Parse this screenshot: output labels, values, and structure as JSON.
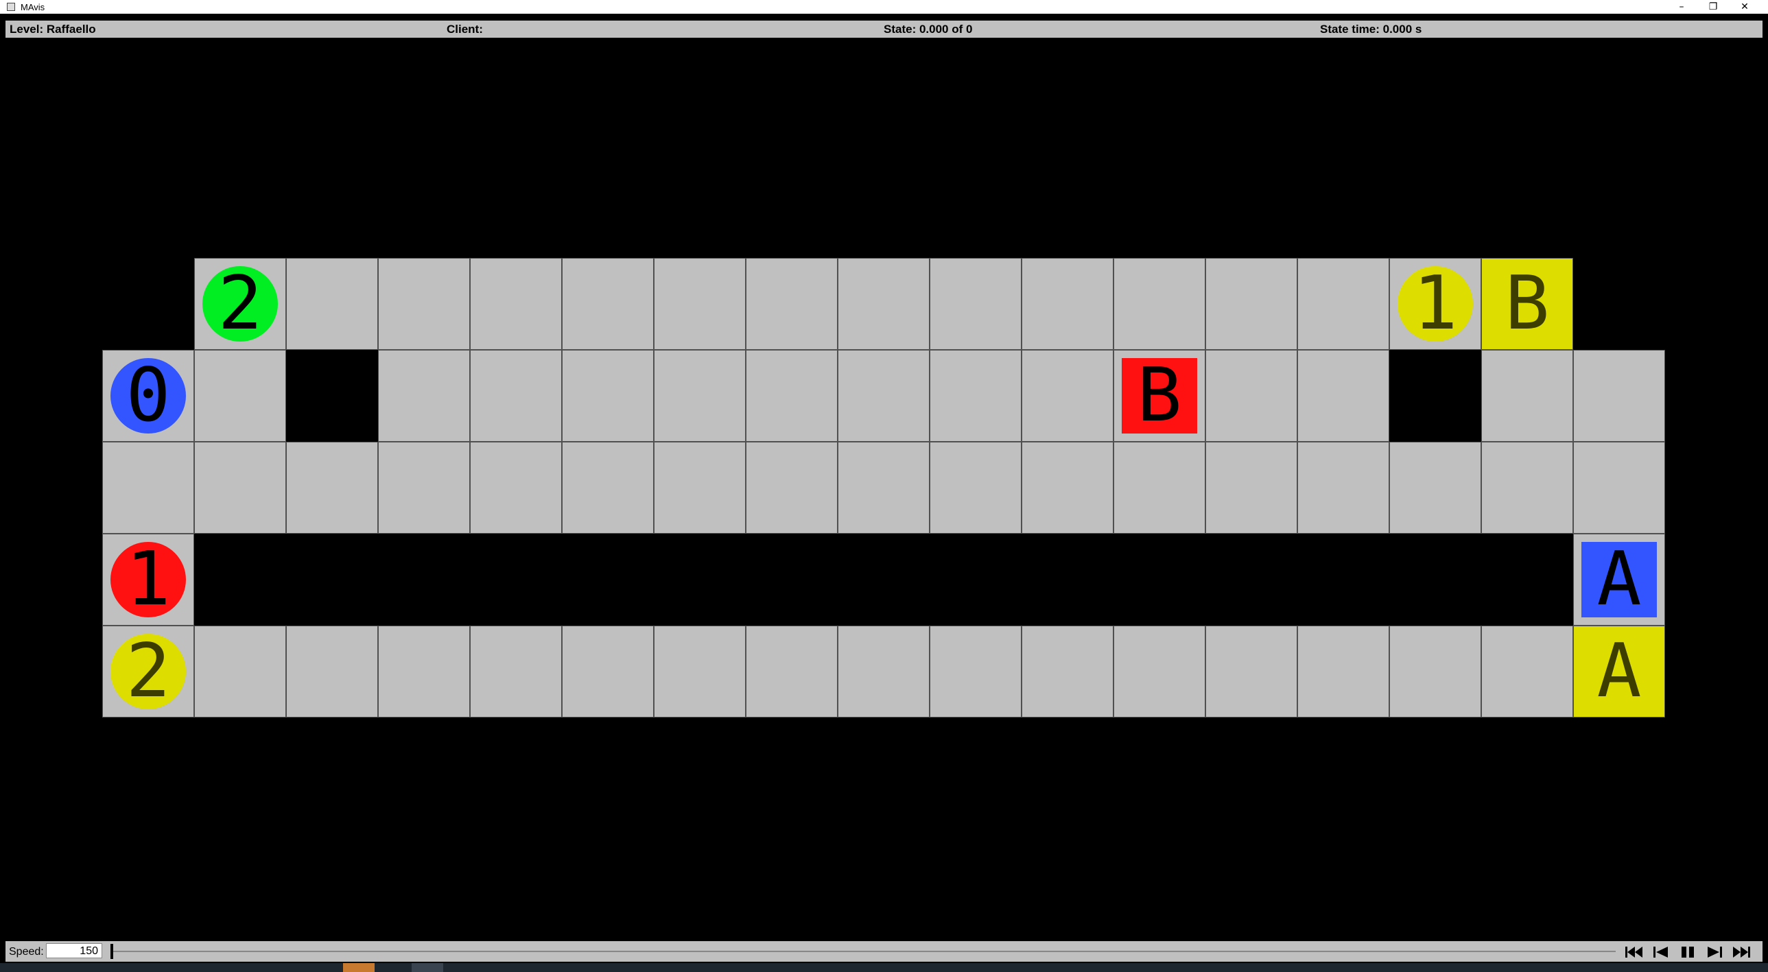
{
  "window": {
    "title": "MAvis",
    "minimize_glyph": "–",
    "restore_glyph": "❐",
    "close_glyph": "✕"
  },
  "status": {
    "level": "Level: Raffaello",
    "client": "Client:",
    "state": "State: 0.000 of 0",
    "state_time": "State time: 0.000 s"
  },
  "board": {
    "rows": 5,
    "cols": 17,
    "walls": [
      [
        0,
        0
      ],
      [
        0,
        16
      ],
      [
        1,
        2
      ],
      [
        1,
        14
      ],
      [
        3,
        1
      ],
      [
        3,
        2
      ],
      [
        3,
        3
      ],
      [
        3,
        4
      ],
      [
        3,
        5
      ],
      [
        3,
        6
      ],
      [
        3,
        7
      ],
      [
        3,
        8
      ],
      [
        3,
        9
      ],
      [
        3,
        10
      ],
      [
        3,
        11
      ],
      [
        3,
        12
      ],
      [
        3,
        13
      ],
      [
        3,
        14
      ],
      [
        3,
        15
      ]
    ],
    "agents": [
      {
        "id": "0",
        "row": 1,
        "col": 0,
        "color": "#3355ff",
        "text_color": "#000000"
      },
      {
        "id": "1",
        "row": 3,
        "col": 0,
        "color": "#ff1111",
        "text_color": "#000000"
      },
      {
        "id": "2",
        "row": 4,
        "col": 0,
        "color": "#dddd00",
        "text_color": "#3d3d00"
      },
      {
        "id": "2",
        "row": 0,
        "col": 1,
        "color": "#00ee22",
        "text_color": "#000000"
      },
      {
        "id": "1",
        "row": 0,
        "col": 14,
        "color": "#dddd00",
        "text_color": "#3d3d00"
      }
    ],
    "boxes": [
      {
        "letter": "B",
        "row": 1,
        "col": 11,
        "color": "#ff1111",
        "text_color": "#000000"
      },
      {
        "letter": "A",
        "row": 3,
        "col": 16,
        "color": "#3355ff",
        "text_color": "#000000"
      }
    ],
    "goals": [
      {
        "letter": "B",
        "row": 0,
        "col": 15,
        "color": "#dddd00",
        "text_color": "#3d3d00"
      },
      {
        "letter": "A",
        "row": 4,
        "col": 16,
        "color": "#dddd00",
        "text_color": "#3d3d00"
      }
    ]
  },
  "controls": {
    "speed_label": "Speed:",
    "speed_value": "150",
    "playback_position": 0,
    "buttons": [
      "skip-to-start-icon",
      "step-back-icon",
      "pause-icon",
      "step-forward-icon",
      "skip-to-end-icon"
    ]
  }
}
